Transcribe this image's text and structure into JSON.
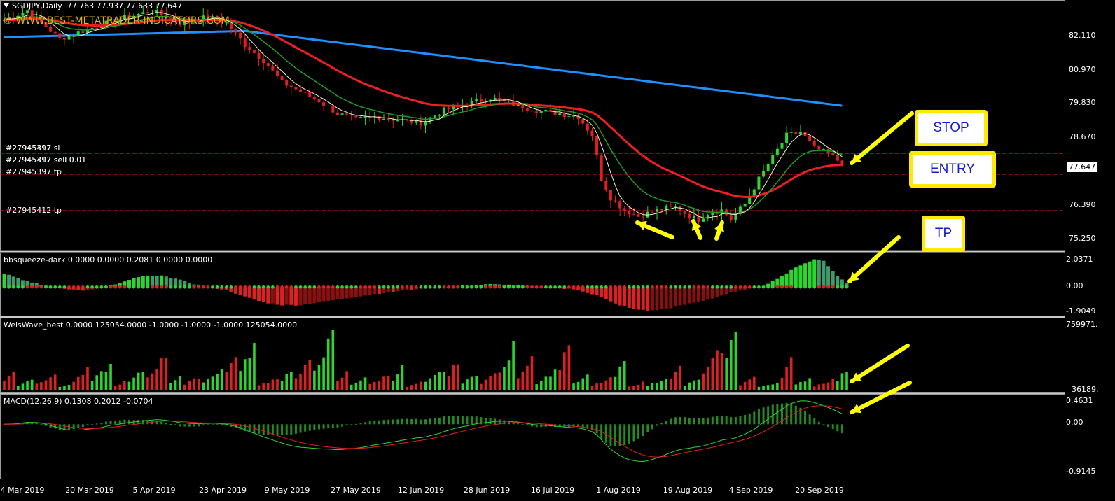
{
  "header": {
    "symbol": "SGDJPY,Daily",
    "ohlc": "77.763 77.937 77.633 77.647",
    "watermark": "© WWW.BEST-METATRADER-INDICATORS.COM"
  },
  "current_price": "77.647",
  "orders": [
    "#27945397 sl",
    "#27945412 sl",
    "#27945397 sell 0.01",
    "#27945412 sell 0.01",
    "#27945397 tp",
    "#27945412 tp"
  ],
  "callouts": {
    "stop": "STOP",
    "entry": "ENTRY",
    "tp": "TP"
  },
  "colors": {
    "background": "#000000",
    "bull": "#2fd52f",
    "bear": "#e02020",
    "ma_fast": "#f0f0c8",
    "ma_mid": "#1f9a1f",
    "ma_slow": "#ee1f1f",
    "ma_long": "#1e90ff",
    "arrow": "#ffff00",
    "callout_border": "#ffea00",
    "callout_text": "#1a1ad6"
  },
  "chart_data": [
    {
      "type": "candlestick",
      "title": "SGDJPY,Daily",
      "y_ticks": [
        "82.110",
        "80.970",
        "79.830",
        "78.670",
        "77.647",
        "76.390",
        "75.250"
      ],
      "ylim": [
        74.9,
        82.9
      ],
      "x_labels": [
        "4 Mar 2019",
        "20 Mar 2019",
        "5 Apr 2019",
        "23 Apr 2019",
        "9 May 2019",
        "27 May 2019",
        "12 Jun 2019",
        "28 Jun 2019",
        "16 Jul 2019",
        "1 Aug 2019",
        "19 Aug 2019",
        "4 Sep 2019",
        "20 Sep 2019"
      ],
      "close_anchors": [
        [
          0,
          82.3
        ],
        [
          5,
          82.6
        ],
        [
          12,
          81.7
        ],
        [
          18,
          82.0
        ],
        [
          24,
          82.3
        ],
        [
          32,
          82.6
        ],
        [
          38,
          82.2
        ],
        [
          44,
          82.4
        ],
        [
          48,
          82.2
        ],
        [
          52,
          81.5
        ],
        [
          56,
          81.0
        ],
        [
          60,
          80.3
        ],
        [
          64,
          80.0
        ],
        [
          68,
          79.7
        ],
        [
          72,
          79.3
        ],
        [
          76,
          79.1
        ],
        [
          80,
          79.2
        ],
        [
          85,
          79.1
        ],
        [
          90,
          79.0
        ],
        [
          95,
          79.4
        ],
        [
          100,
          79.6
        ],
        [
          105,
          79.8
        ],
        [
          110,
          79.6
        ],
        [
          115,
          79.4
        ],
        [
          120,
          79.3
        ],
        [
          124,
          79.2
        ],
        [
          127,
          78.6
        ],
        [
          129,
          77.2
        ],
        [
          131,
          76.6
        ],
        [
          134,
          76.2
        ],
        [
          137,
          76.0
        ],
        [
          141,
          76.2
        ],
        [
          145,
          76.3
        ],
        [
          148,
          76.0
        ],
        [
          150,
          75.9
        ],
        [
          152,
          76.1
        ],
        [
          155,
          76.2
        ],
        [
          157,
          75.9
        ],
        [
          160,
          76.4
        ],
        [
          163,
          77.2
        ],
        [
          166,
          77.9
        ],
        [
          169,
          78.6
        ],
        [
          172,
          78.7
        ],
        [
          175,
          78.2
        ],
        [
          178,
          78.0
        ],
        [
          180,
          77.8
        ],
        [
          181,
          77.647
        ]
      ],
      "levels": {
        "sl": 78.02,
        "entry": 77.35,
        "tp": 76.18
      },
      "moving_averages": [
        {
          "type": "ma_fast",
          "period": 5
        },
        {
          "type": "ma_mid",
          "period": 13
        },
        {
          "type": "ma_slow",
          "period": 34
        },
        {
          "type": "ma_long",
          "period": 200,
          "start": 81.75,
          "peak": 81.95,
          "end": 79.55
        }
      ]
    },
    {
      "type": "bar",
      "title": "bbsqueeze-dark",
      "header_values": "0.0000 0.0000 0.2081 0.0000 0.0000",
      "y_ticks": [
        "2.0371",
        "0.00",
        "-1.9049"
      ],
      "ylim": [
        -1.9049,
        2.0371
      ],
      "anchors": [
        [
          0,
          1.0
        ],
        [
          6,
          0.3
        ],
        [
          12,
          -0.1
        ],
        [
          18,
          -0.25
        ],
        [
          24,
          0.2
        ],
        [
          30,
          0.8
        ],
        [
          35,
          0.8
        ],
        [
          40,
          0.3
        ],
        [
          44,
          0.0
        ],
        [
          48,
          -0.2
        ],
        [
          52,
          -0.7
        ],
        [
          56,
          -1.1
        ],
        [
          60,
          -1.3
        ],
        [
          64,
          -1.3
        ],
        [
          68,
          -1.1
        ],
        [
          72,
          -0.9
        ],
        [
          76,
          -0.7
        ],
        [
          80,
          -0.5
        ],
        [
          85,
          -0.3
        ],
        [
          90,
          -0.1
        ],
        [
          95,
          0.0
        ],
        [
          100,
          0.1
        ],
        [
          105,
          0.2
        ],
        [
          110,
          0.15
        ],
        [
          115,
          0.0
        ],
        [
          120,
          -0.1
        ],
        [
          124,
          -0.2
        ],
        [
          128,
          -0.6
        ],
        [
          132,
          -1.2
        ],
        [
          136,
          -1.6
        ],
        [
          140,
          -1.7
        ],
        [
          144,
          -1.5
        ],
        [
          148,
          -1.2
        ],
        [
          152,
          -0.9
        ],
        [
          156,
          -0.5
        ],
        [
          160,
          -0.2
        ],
        [
          164,
          0.1
        ],
        [
          168,
          0.8
        ],
        [
          172,
          1.6
        ],
        [
          175,
          2.0
        ],
        [
          177,
          1.9
        ],
        [
          180,
          0.8
        ],
        [
          182,
          0.3
        ]
      ]
    },
    {
      "type": "bar",
      "title": "WeisWave_best",
      "header_values": "0.0000 125054.0000 -1.0000 -1.0000 -1.0000 125054.0000",
      "y_ticks": [
        "759971.",
        "36189."
      ],
      "ylim": [
        0,
        760000
      ],
      "wave_peaks": [
        200000,
        120000,
        180000,
        60000,
        220000,
        270000,
        90000,
        210000,
        380000,
        160000,
        140000,
        230000,
        400000,
        500000,
        130000,
        220000,
        300000,
        600000,
        190000,
        140000,
        160000,
        250000,
        80000,
        220000,
        330000,
        170000,
        210000,
        480000,
        370000,
        200000,
        540000,
        150000,
        120000,
        310000,
        80000,
        130000,
        250000,
        120000,
        460000,
        700000,
        140000,
        80000,
        330000,
        130000,
        110000,
        220000,
        90000,
        130000
      ]
    },
    {
      "type": "line",
      "title": "MACD(12,26,9)",
      "header_values": "0.1308 0.2012 -0.0704",
      "y_ticks": [
        "0.4631",
        "0.00",
        "-0.9145"
      ],
      "ylim": [
        -0.9145,
        0.4631
      ]
    }
  ]
}
